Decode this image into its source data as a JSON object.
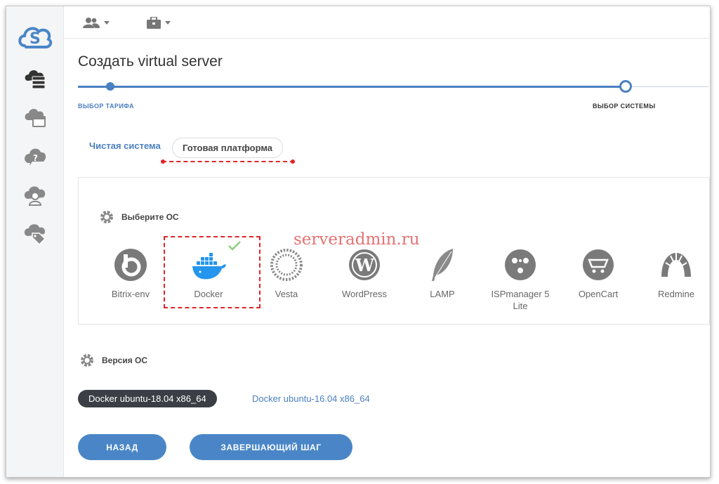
{
  "topbar": {
    "users_icon": "users-icon",
    "briefcase_icon": "briefcase-icon"
  },
  "page": {
    "title": "Создать virtual server"
  },
  "wizard": {
    "step1": "ВЫБОР ТАРИФА",
    "step2": "ВЫБОР СИСТЕМЫ"
  },
  "tabs": {
    "plain": "Чистая система",
    "ready": "Готовая платформа"
  },
  "os_section": {
    "title": "Выберите ОС"
  },
  "watermark": "serveradmin.ru",
  "os_list": [
    {
      "label": "Bitrix-env",
      "icon": "bitrix-icon"
    },
    {
      "label": "Docker",
      "icon": "docker-icon",
      "selected": true
    },
    {
      "label": "Vesta",
      "icon": "vesta-icon"
    },
    {
      "label": "WordPress",
      "icon": "wordpress-icon"
    },
    {
      "label": "LAMP",
      "icon": "feather-icon"
    },
    {
      "label": "ISPmanager 5 Lite",
      "icon": "ispmanager-icon"
    },
    {
      "label": "OpenCart",
      "icon": "opencart-icon"
    },
    {
      "label": "Redmine",
      "icon": "redmine-icon"
    }
  ],
  "version_section": {
    "title": "Версия ОС"
  },
  "versions": {
    "selected": "Docker ubuntu-18.04 x86_64",
    "other": "Docker ubuntu-16.04 x86_64"
  },
  "buttons": {
    "back": "НАЗАД",
    "final": "ЗАВЕРШАЮЩИЙ ШАГ"
  },
  "colors": {
    "accent": "#4a7fc1",
    "button": "#4a86c7",
    "annotation": "#e0252b",
    "pill": "#3b3f45"
  }
}
